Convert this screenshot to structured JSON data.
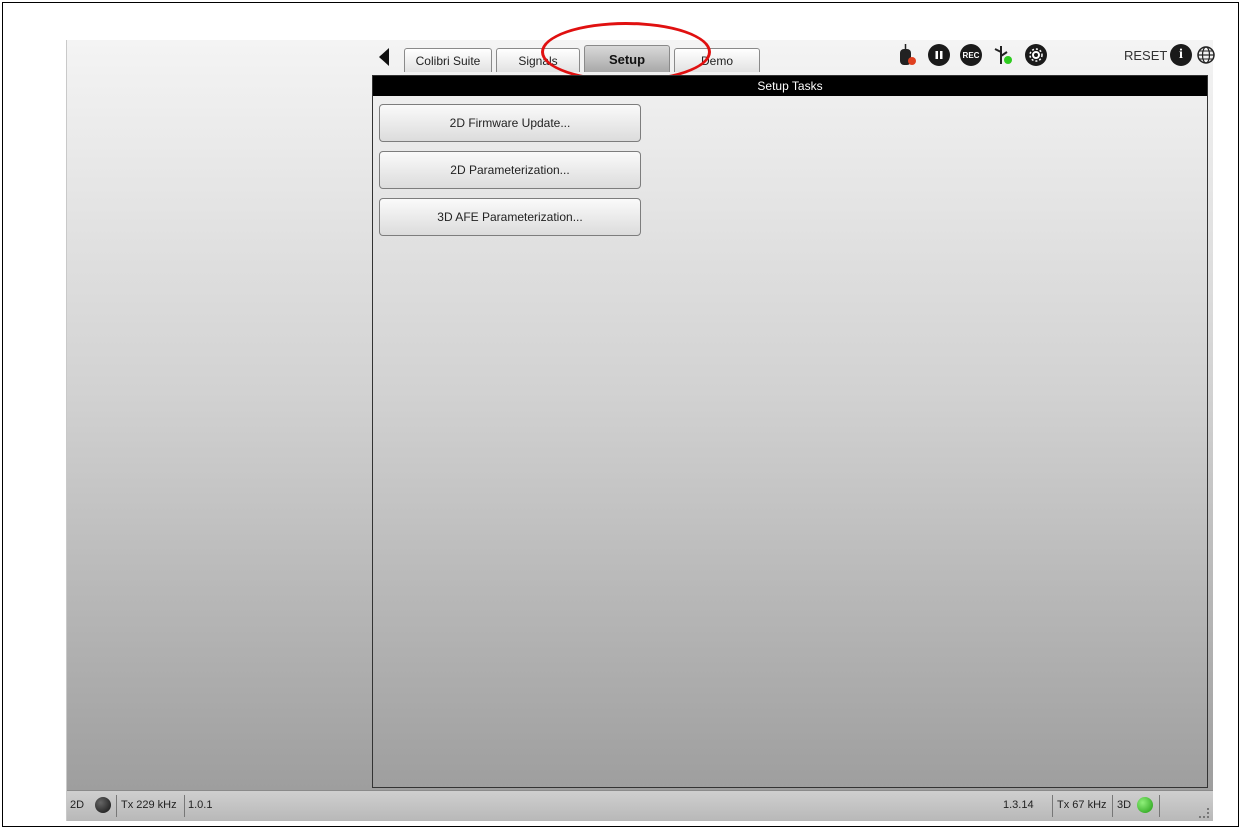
{
  "nav": {
    "tabs": [
      {
        "label": "Colibri Suite"
      },
      {
        "label": "Signals"
      },
      {
        "label": "Setup"
      },
      {
        "label": "Demo"
      }
    ],
    "active_tab": "Setup"
  },
  "toolbar": {
    "icons": [
      "mouse-icon",
      "pause-icon",
      "record-icon",
      "usb-icon",
      "settings-icon",
      "info-icon",
      "globe-icon"
    ],
    "record_label": "REC",
    "info_label": "i",
    "reset_label": "RESET"
  },
  "panel": {
    "title": "Setup Tasks",
    "tasks": [
      {
        "label": "2D Firmware Update..."
      },
      {
        "label": "2D Parameterization..."
      },
      {
        "label": "3D AFE Parameterization..."
      }
    ]
  },
  "status_bar": {
    "left_mode": "2D",
    "left_tx": "Tx 229 kHz",
    "left_version": "1.0.1",
    "right_version": "1.3.14",
    "right_tx": "Tx 67 kHz",
    "right_mode": "3D"
  },
  "colors": {
    "highlight": "#e01010",
    "led_left": "#111111",
    "led_right": "#2ecc1f"
  }
}
